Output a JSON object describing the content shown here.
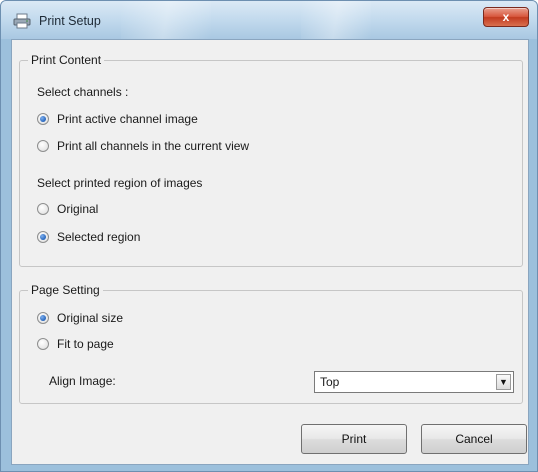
{
  "window": {
    "title": "Print Setup",
    "close_symbol": "x",
    "title_icon": "printer-icon"
  },
  "print_content": {
    "legend": "Print Content",
    "channels_label": "Select channels :",
    "channel_options": [
      {
        "label": "Print active channel image",
        "checked": true
      },
      {
        "label": "Print all channels in the current view",
        "checked": false
      }
    ],
    "region_label": "Select printed region of images",
    "region_options": [
      {
        "label": "Original",
        "checked": false
      },
      {
        "label": "Selected region",
        "checked": true
      }
    ]
  },
  "page_setting": {
    "legend": "Page Setting",
    "size_options": [
      {
        "label": "Original size",
        "checked": true
      },
      {
        "label": "Fit to page",
        "checked": false
      }
    ],
    "align_label": "Align Image:",
    "align_value": "Top"
  },
  "buttons": {
    "print": "Print",
    "cancel": "Cancel"
  }
}
